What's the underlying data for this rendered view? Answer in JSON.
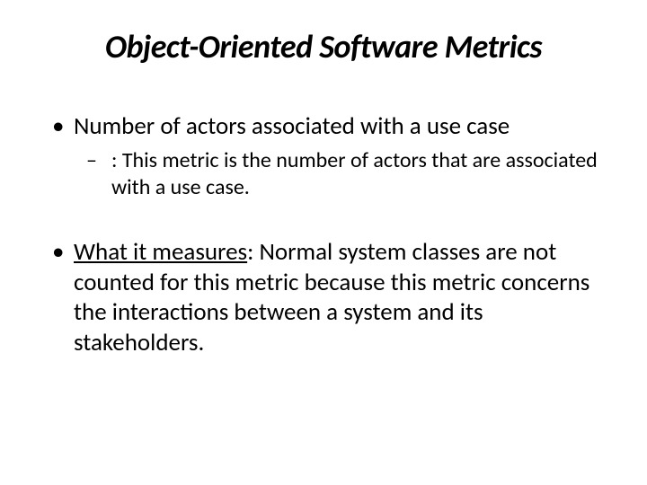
{
  "title": "Object-Oriented Software Metrics",
  "bullets": {
    "b1": {
      "text": "Number of actors associated with a use case",
      "sub": {
        "s1": ": This metric is the number of actors that are associated with a use case."
      }
    },
    "b2": {
      "label": "What it measures",
      "rest": ": Normal system classes are not counted for this metric because this metric concerns the interactions between a system and its stakeholders."
    }
  }
}
